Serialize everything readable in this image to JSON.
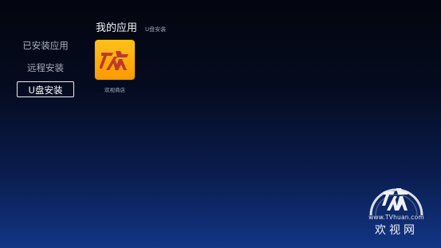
{
  "sidebar": {
    "items": [
      {
        "label": "已安装应用"
      },
      {
        "label": "远程安装"
      },
      {
        "label": "U盘安装"
      }
    ],
    "selected": "U盘安装"
  },
  "main": {
    "title": "我的应用",
    "subtitle": "U盘安装",
    "apps": [
      {
        "name": "欢视商店",
        "icon": "tvhuan-store-icon"
      }
    ]
  },
  "watermark": {
    "url": "www.TVhuan.com",
    "brand": "欢视网",
    "logo": "tvhuan-logo-icon"
  },
  "colors": {
    "app_icon_bg": "#ffb000",
    "logo_mark": "#c0392b",
    "background_top": "#03060f",
    "background_bottom": "#123585"
  }
}
